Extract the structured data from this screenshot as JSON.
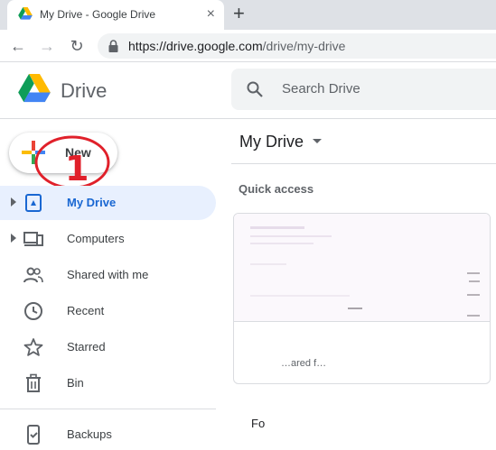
{
  "browser": {
    "tab_title": "My Drive - Google Drive",
    "tab_close": "×",
    "new_tab": "+",
    "url_host": "https://drive.google.com",
    "url_path": "/drive/my-drive",
    "back_icon": "←",
    "forward_icon": "→",
    "reload_icon": "↻"
  },
  "header": {
    "app_name": "Drive",
    "search_placeholder": "Search Drive"
  },
  "sidebar": {
    "new_button": "New",
    "annotation_number": "1",
    "items": [
      {
        "label": "My Drive",
        "icon": "my-drive-icon",
        "active": true,
        "expandable": true
      },
      {
        "label": "Computers",
        "icon": "computers-icon",
        "active": false,
        "expandable": true
      },
      {
        "label": "Shared with me",
        "icon": "shared-icon",
        "active": false,
        "expandable": false
      },
      {
        "label": "Recent",
        "icon": "recent-clock-icon",
        "active": false,
        "expandable": false
      },
      {
        "label": "Starred",
        "icon": "star-icon",
        "active": false,
        "expandable": false
      },
      {
        "label": "Bin",
        "icon": "bin-icon",
        "active": false,
        "expandable": false
      },
      {
        "label": "Backups",
        "icon": "backups-icon",
        "active": false,
        "expandable": false
      }
    ]
  },
  "main": {
    "title": "My Drive",
    "quick_access": "Quick access",
    "file_card_name": "…ared f…",
    "folders_label": "Fo"
  },
  "colors": {
    "accent": "#1967d2",
    "active_bg": "#e8f0fe",
    "annotation": "#e0202a"
  }
}
